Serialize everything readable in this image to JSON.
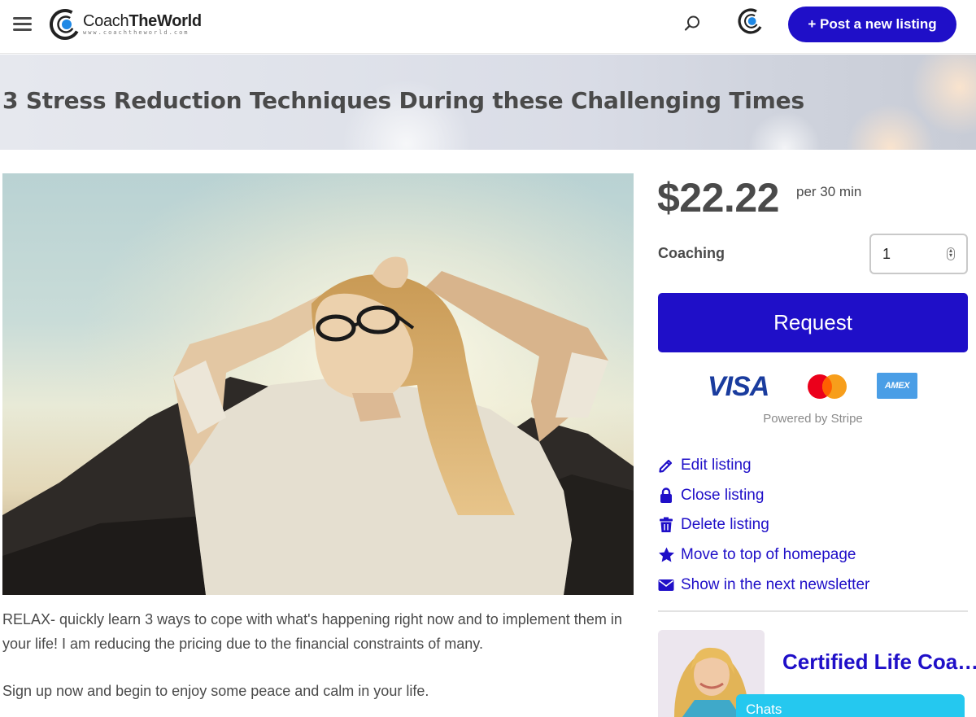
{
  "header": {
    "logo_name_regular": "Coach",
    "logo_name_bold": "TheWorld",
    "logo_url": "www.coachtheworld.com",
    "post_button_label": "+ Post a new listing"
  },
  "listing": {
    "title": "3 Stress Reduction Techniques During these Challenging Times",
    "price": "$22.22",
    "price_unit": "per 30 min",
    "quantity_label": "Coaching",
    "quantity_value": "1",
    "request_label": "Request",
    "payment_cards": [
      "VISA",
      "Mastercard",
      "AMEX"
    ],
    "powered_by": "Powered by Stripe",
    "description": [
      "RELAX- quickly learn 3 ways to cope with what's happening right now and to implement them in your life! I am reducing the pricing due to the financial constraints of many.",
      "Sign up now and begin to enjoy some peace and calm in your life."
    ]
  },
  "actions": [
    {
      "label": "Edit listing",
      "icon": "pencil-icon"
    },
    {
      "label": "Close listing",
      "icon": "lock-icon"
    },
    {
      "label": "Delete listing",
      "icon": "trash-icon"
    },
    {
      "label": "Move to top of homepage",
      "icon": "star-icon"
    },
    {
      "label": "Show in the next newsletter",
      "icon": "envelope-icon"
    }
  ],
  "author": {
    "name": "Certified Life Coa…"
  },
  "chat": {
    "label": "Chats"
  },
  "colors": {
    "brand": "#1f0fc8",
    "chat": "#25c8ef",
    "text": "#4a4a4a"
  }
}
